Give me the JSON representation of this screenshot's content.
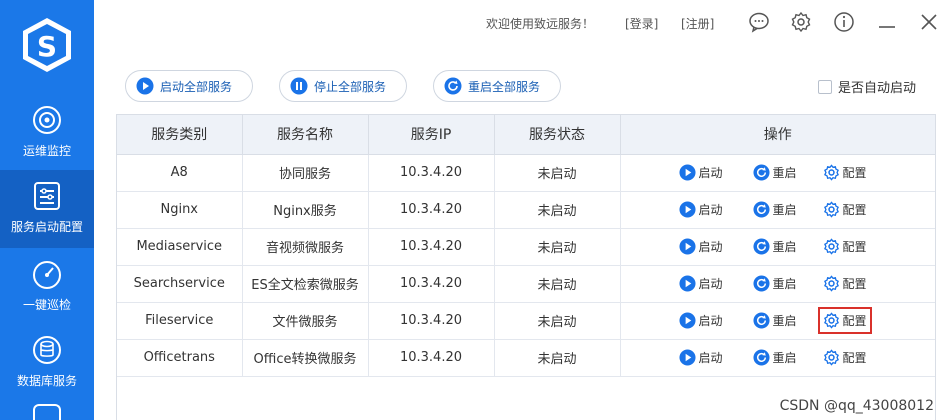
{
  "colors": {
    "sidebar": "#1b78e8",
    "sidebar_active": "#1461c4",
    "accent": "#1a73e8",
    "highlight": "#d9312b"
  },
  "sidebar": {
    "items": [
      {
        "label": "运维监控",
        "icon": "monitor-icon"
      },
      {
        "label": "服务启动配置",
        "icon": "config-icon"
      },
      {
        "label": "一键巡检",
        "icon": "gauge-icon"
      },
      {
        "label": "数据库服务",
        "icon": "database-icon"
      }
    ]
  },
  "header": {
    "welcome": "欢迎使用致远服务！",
    "login": "[登录]",
    "register": "[注册]"
  },
  "toolbar": {
    "start_all": "启动全部服务",
    "stop_all": "停止全部服务",
    "restart_all": "重启全部服务",
    "auto_start": "是否自动启动"
  },
  "table": {
    "headers": [
      "服务类别",
      "服务名称",
      "服务IP",
      "服务状态",
      "操作"
    ],
    "actions": {
      "start": "启动",
      "restart": "重启",
      "config": "配置"
    },
    "rows": [
      {
        "category": "A8",
        "name": "协同服务",
        "ip": "10.3.4.20",
        "status": "未启动"
      },
      {
        "category": "Nginx",
        "name": "Nginx服务",
        "ip": "10.3.4.20",
        "status": "未启动"
      },
      {
        "category": "Mediaservice",
        "name": "音视频微服务",
        "ip": "10.3.4.20",
        "status": "未启动"
      },
      {
        "category": "Searchservice",
        "name": "ES全文检索微服务",
        "ip": "10.3.4.20",
        "status": "未启动"
      },
      {
        "category": "Fileservice",
        "name": "文件微服务",
        "ip": "10.3.4.20",
        "status": "未启动"
      },
      {
        "category": "Officetrans",
        "name": "Office转换微服务",
        "ip": "10.3.4.20",
        "status": "未启动"
      }
    ]
  },
  "watermark": "CSDN @qq_43008012"
}
